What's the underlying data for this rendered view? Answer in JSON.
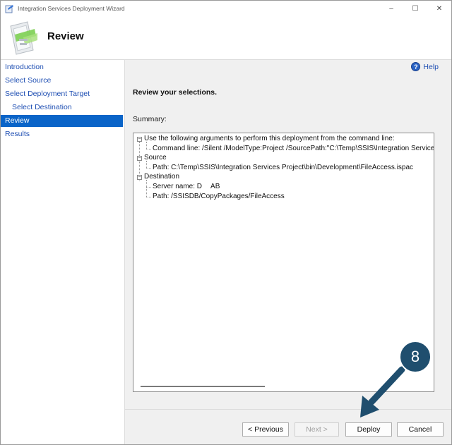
{
  "window": {
    "title": "Integration Services Deployment Wizard",
    "controls": {
      "minimize": "–",
      "maximize": "☐",
      "close": "✕"
    }
  },
  "header": {
    "title": "Review"
  },
  "sidebar": {
    "items": [
      {
        "label": "Introduction",
        "active": false,
        "sub": false
      },
      {
        "label": "Select Source",
        "active": false,
        "sub": false
      },
      {
        "label": "Select Deployment Target",
        "active": false,
        "sub": false
      },
      {
        "label": "Select Destination",
        "active": false,
        "sub": true
      },
      {
        "label": "Review",
        "active": true,
        "sub": false
      },
      {
        "label": "Results",
        "active": false,
        "sub": false
      }
    ]
  },
  "content": {
    "help_label": "Help",
    "help_icon": "help-icon",
    "heading": "Review your selections.",
    "summary_label": "Summary:",
    "tree": {
      "args_label": "Use the following arguments to perform this deployment from the command line:",
      "command_line": "Command line: /Silent /ModelType:Project /SourcePath:\"C:\\Temp\\SSIS\\Integration Services Pr",
      "source_label": "Source",
      "source_path": "Path: C:\\Temp\\SSIS\\Integration Services Project\\bin\\Development\\FileAccess.ispac",
      "destination_label": "Destination",
      "server_name": "Server name: D      AB",
      "dest_path": "Path: /SSISDB/CopyPackages/FileAccess"
    }
  },
  "footer": {
    "previous": "< Previous",
    "next": "Next >",
    "deploy": "Deploy",
    "cancel": "Cancel"
  },
  "callout": {
    "number": "8",
    "color": "#1f4e6e"
  }
}
